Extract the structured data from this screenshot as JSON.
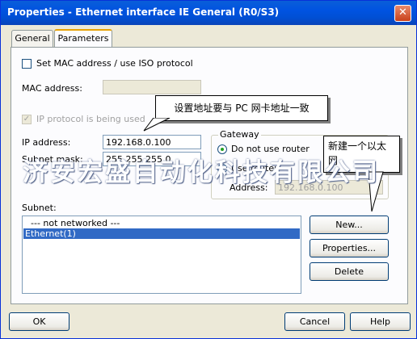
{
  "window": {
    "title": "Properties - Ethernet interface  IE General (R0/S3)",
    "close_glyph": "✕"
  },
  "tabs": [
    {
      "label": "General"
    },
    {
      "label": "Parameters"
    }
  ],
  "parameters": {
    "set_mac_label": "Set MAC address / use ISO protocol",
    "mac_address_label": "MAC address:",
    "mac_address_value": "",
    "ip_protocol_label": "IP protocol is being used",
    "ip_address_label": "IP address:",
    "ip_address_value": "192.168.0.100",
    "subnet_mask_label": "Subnet mask:",
    "subnet_mask_value": "255.255.255.0",
    "gateway": {
      "title": "Gateway",
      "do_not_use_router": "Do not use router",
      "use_router": "Use router",
      "address_label": "Address:",
      "address_value": "192.168.0.100"
    },
    "subnet_label": "Subnet:",
    "subnet_items": [
      "--- not networked ---",
      "Ethernet(1)"
    ],
    "new_button": "New...",
    "properties_button": "Properties...",
    "delete_button": "Delete"
  },
  "footer": {
    "ok": "OK",
    "cancel": "Cancel",
    "help": "Help"
  },
  "annotations": {
    "callout_ip": "设置地址要与 PC 网卡地址一致",
    "callout_new": "新建一个以太网"
  },
  "watermark": "济安宏盛自动化科技有限公司"
}
